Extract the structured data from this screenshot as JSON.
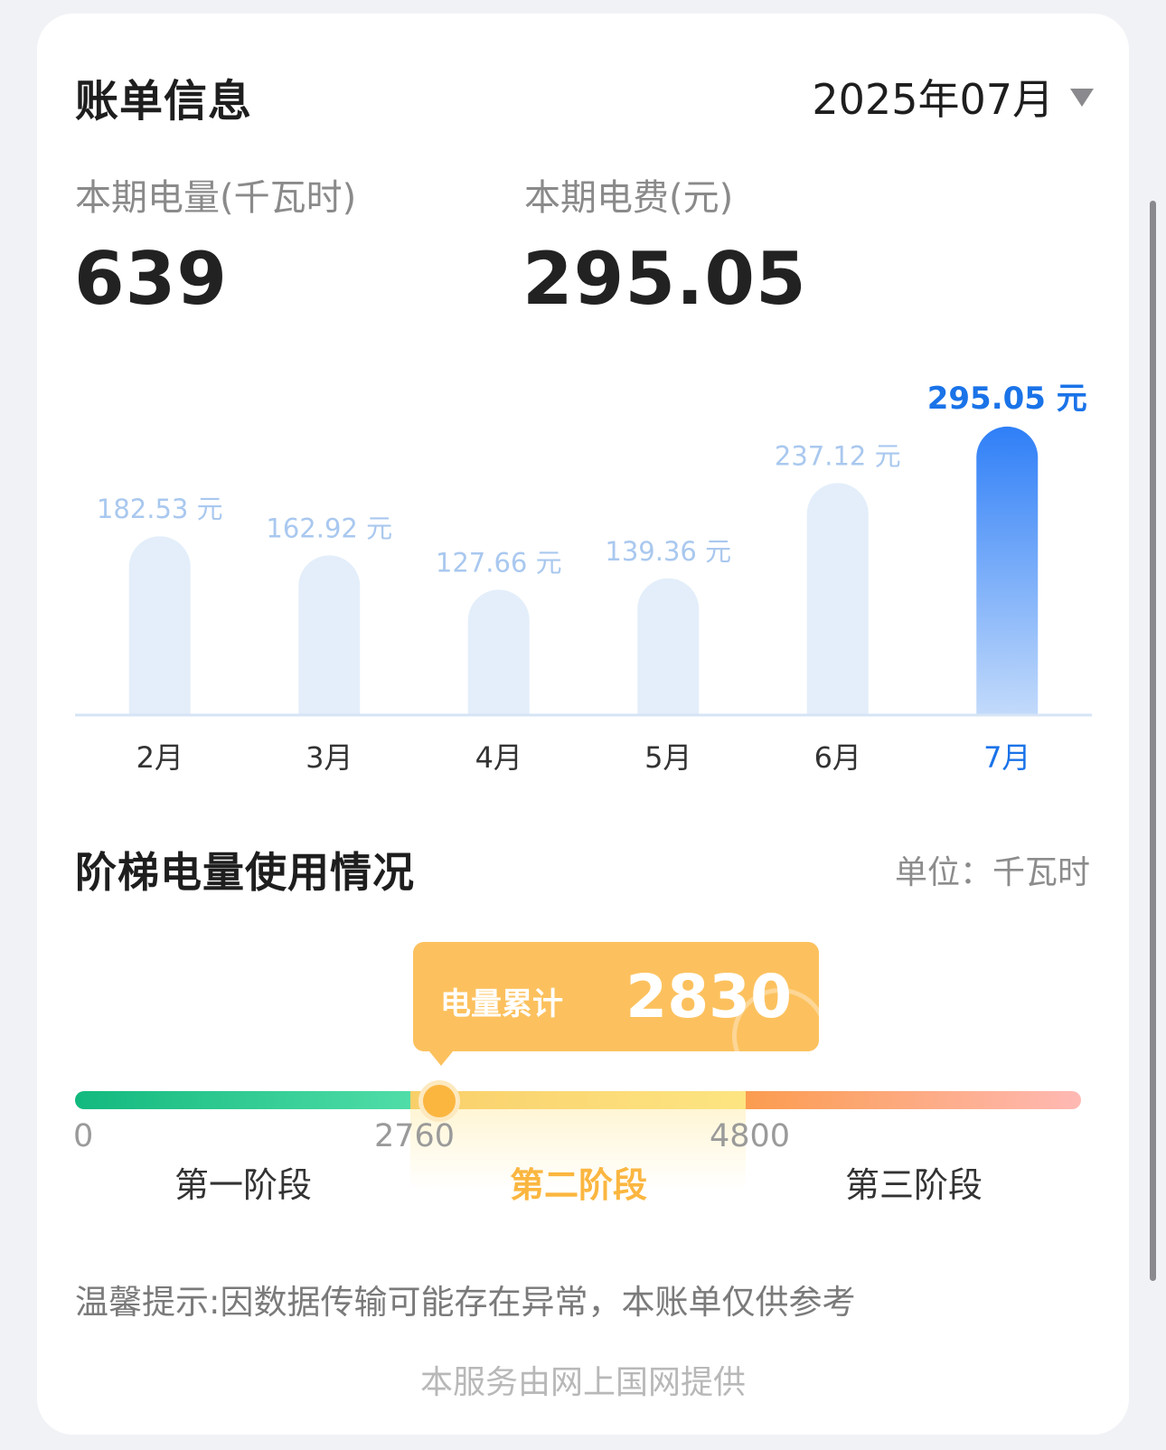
{
  "header": {
    "title": "账单信息",
    "month_selected": "2025年07月"
  },
  "stats": {
    "usage_label": "本期电量(千瓦时)",
    "usage_value": "639",
    "fee_label": "本期电费(元)",
    "fee_value": "295.05"
  },
  "chart_data": {
    "type": "bar",
    "categories": [
      "2月",
      "3月",
      "4月",
      "5月",
      "6月",
      "7月"
    ],
    "values": [
      182.53,
      162.92,
      127.66,
      139.36,
      237.12,
      295.05
    ],
    "value_labels": [
      "182.53 元",
      "162.92 元",
      "127.66 元",
      "139.36 元",
      "237.12 元",
      "295.05 元"
    ],
    "highlight_index": 5,
    "colors": {
      "bar": "#e3eefa",
      "bar_label": "#a9c8ef",
      "highlight_top": "#2f7ff7",
      "highlight_bottom": "#c2dafb",
      "highlight_label": "#1a73e8",
      "axis": "#d6e4f5"
    }
  },
  "tier": {
    "title": "阶梯电量使用情况",
    "unit": "单位：千瓦时",
    "tooltip_label": "电量累计",
    "tooltip_value": "2830",
    "current_usage": 2830,
    "range_max": 7200,
    "ticks": [
      "0",
      "2760",
      "4800"
    ],
    "stages": [
      "第一阶段",
      "第二阶段",
      "第三阶段"
    ],
    "active_stage_index": 1,
    "colors": {
      "stage1": "#12b97e",
      "stage2": "#fde582",
      "stage3": "#fb9c4f",
      "accent": "#fbb640"
    }
  },
  "notice": "温馨提示:因数据传输可能存在异常，本账单仅供参考",
  "footer": "本服务由网上国网提供"
}
